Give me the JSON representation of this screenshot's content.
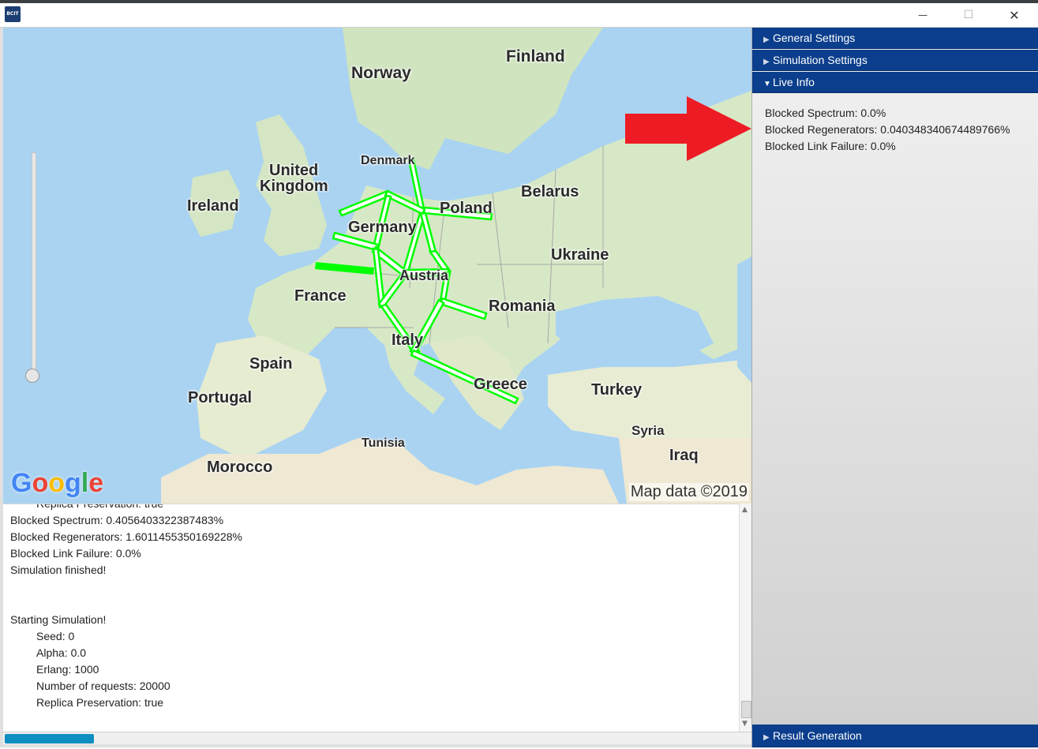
{
  "window": {
    "app_icon_text": "BCIT",
    "minimize_glyph": "—",
    "maximize_glyph": "☐",
    "close_glyph": "✕"
  },
  "map": {
    "labels": {
      "finland": "Finland",
      "norway": "Norway",
      "denmark": "Denmark",
      "united_kingdom_1": "United",
      "united_kingdom_2": "Kingdom",
      "ireland": "Ireland",
      "belarus": "Belarus",
      "poland": "Poland",
      "germany": "Germany",
      "ukraine": "Ukraine",
      "france": "France",
      "austria": "Austria",
      "romania": "Romania",
      "italy": "Italy",
      "spain": "Spain",
      "portugal": "Portugal",
      "greece": "Greece",
      "turkey": "Turkey",
      "syria": "Syria",
      "iraq": "Iraq",
      "tunisia": "Tunisia",
      "morocco": "Morocco"
    },
    "attribution": "Map data ©2019",
    "logo_letters": [
      "G",
      "o",
      "o",
      "g",
      "l",
      "e"
    ],
    "logo_colors": [
      "#4285F4",
      "#EA4335",
      "#FBBC05",
      "#4285F4",
      "#34A853",
      "#EA4335"
    ],
    "link_color": "#00ff00",
    "zoom_slider_level": 0.0
  },
  "console": {
    "lines": [
      {
        "text": "Replica Preservation: true",
        "indent": true
      },
      {
        "text": "Blocked Spectrum: 0.4056403322387483%",
        "indent": false
      },
      {
        "text": "Blocked Regenerators: 1.6011455350169228%",
        "indent": false
      },
      {
        "text": "Blocked Link Failure: 0.0%",
        "indent": false
      },
      {
        "text": "Simulation finished!",
        "indent": false
      },
      {
        "text": "",
        "indent": false
      },
      {
        "text": "",
        "indent": false
      },
      {
        "text": "Starting Simulation!",
        "indent": false
      },
      {
        "text": "Seed: 0",
        "indent": true
      },
      {
        "text": "Alpha: 0.0",
        "indent": true
      },
      {
        "text": "Erlang: 1000",
        "indent": true
      },
      {
        "text": "Number of requests: 20000",
        "indent": true
      },
      {
        "text": "Replica Preservation: true",
        "indent": true
      }
    ]
  },
  "progress": {
    "fraction": 0.12,
    "color": "#0f8fc1"
  },
  "side_panel": {
    "general_settings": "General Settings",
    "simulation_settings": "Simulation Settings",
    "live_info": "Live Info",
    "result_generation": "Result Generation",
    "live": {
      "blocked_spectrum": "Blocked Spectrum: 0.0%",
      "blocked_regenerators": "Blocked Regenerators: 0.040348340674489766%",
      "blocked_link_failure": "Blocked Link Failure: 0.0%"
    },
    "header_color": "#0b3e8c",
    "annotation_arrow_color": "#ed1c24"
  }
}
